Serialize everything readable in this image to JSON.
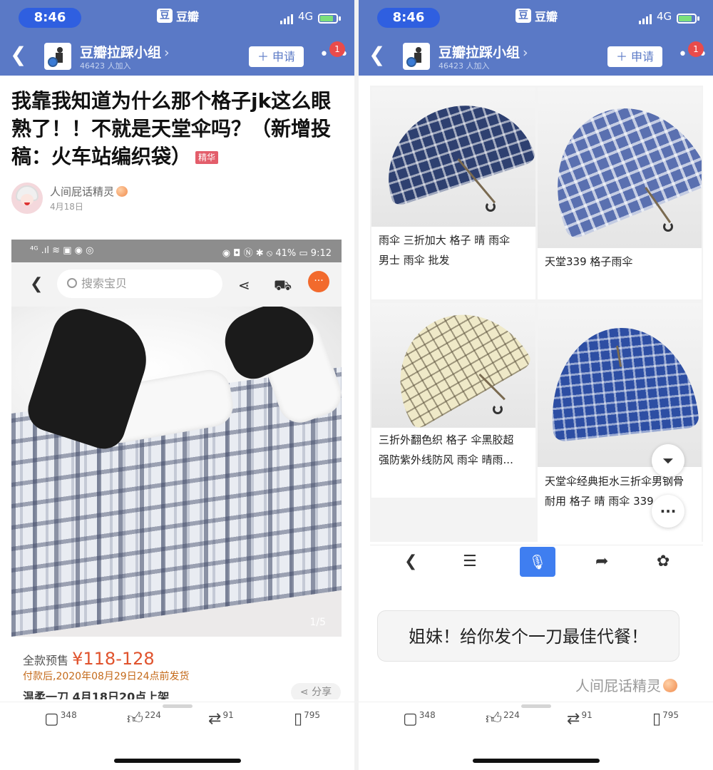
{
  "status_bar": {
    "time": "8:46",
    "network": "4G",
    "app_name": "豆瓣",
    "app_icon_char": "豆"
  },
  "group": {
    "name": "豆瓣拉踩小组",
    "members": "46423 人加入",
    "apply_label": "＋ 申请",
    "notification_count": "1"
  },
  "post": {
    "title": "我靠我知道为什么那个格子jk这么眼熟了！！不就是天堂伞吗？（新增投稿：火车站编织袋）",
    "badge": "精华",
    "author": "人间屁话精灵",
    "date": "4月18日"
  },
  "embedded_shop": {
    "phone_status_left": "⁴ᴳ .ıl ≋ ▣ ◉ ◎",
    "phone_status_right": "◉ ◘ Ⓝ ✱ ⦸ 41% ▭ 9:12",
    "search_placeholder": "搜索宝贝",
    "image_counter": "1/5",
    "price_label": "全款预售",
    "price_value": "¥118-128",
    "ship_info": "付款后,2020年08月29日24点前发货",
    "launch_info": "温柔一刀 4月18日20点上架",
    "share_label": "分享"
  },
  "products": [
    {
      "title_line1": "雨伞 三折加大 格子 晴 雨伞",
      "title_line2": "男士 雨伞 批发"
    },
    {
      "title_line1": "天堂339 格子雨伞",
      "title_line2": ""
    },
    {
      "title_line1": "三折外翻色织 格子 伞黑胶超",
      "title_line2": "强防紫外线防风 雨伞 晴雨..."
    },
    {
      "title_line1": "天堂伞经典拒水三折伞男钢骨",
      "title_line2": "耐用 格子 晴 雨伞 339..."
    }
  ],
  "reply": {
    "text": "姐妹！给你发个一刀最佳代餐！",
    "author": "人间屁话精灵"
  },
  "actions": {
    "comments": "348",
    "likes": "224",
    "reshares": "91",
    "collects": "795"
  },
  "colors": {
    "header": "#5a79c6",
    "accent_price": "#e0532d",
    "mic": "#3f7ef0"
  },
  "icons": [
    "back-icon",
    "chevron-right-icon",
    "more-icon",
    "search-icon",
    "share-icon",
    "cart-icon",
    "filter-icon",
    "mic-icon",
    "forward-icon",
    "paw-icon",
    "comment-icon",
    "like-icon",
    "reshare-icon",
    "collect-icon"
  ]
}
